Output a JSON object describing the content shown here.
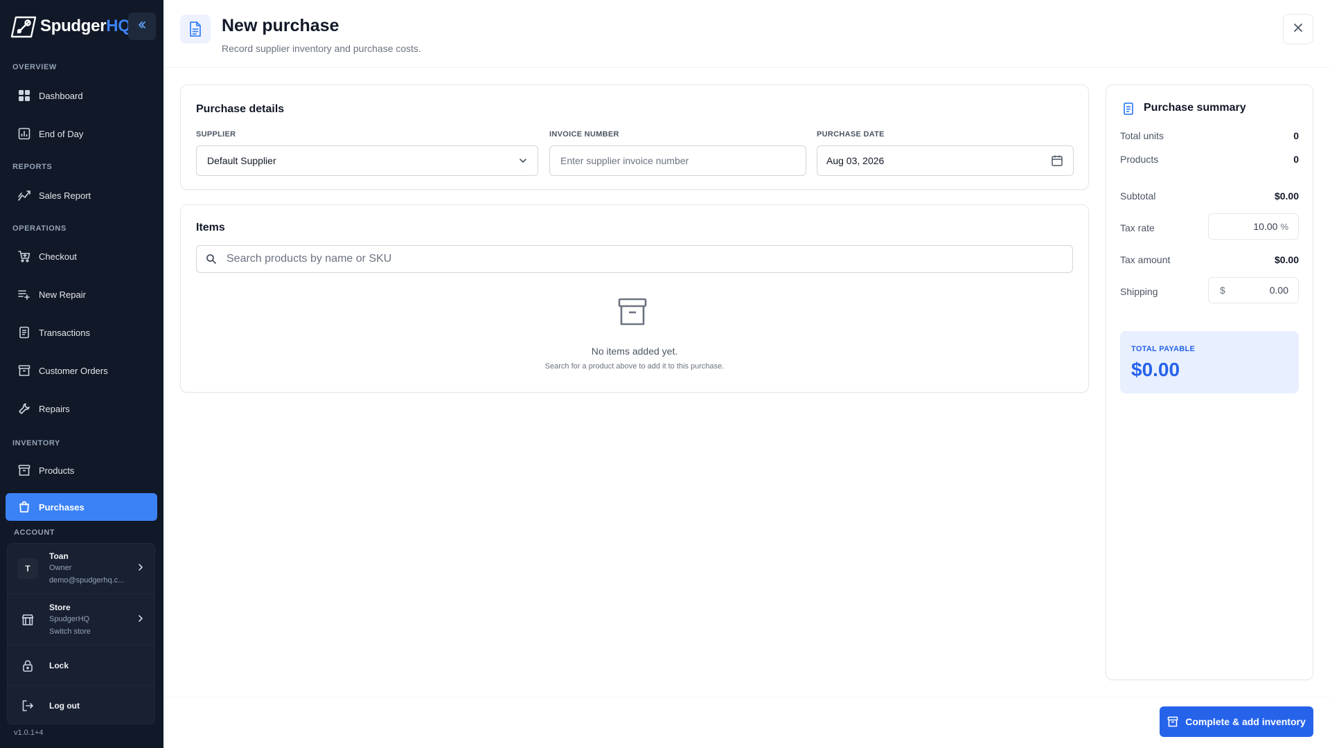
{
  "brand": {
    "name_main": "Spudger",
    "name_accent": "HQ"
  },
  "sidebar": {
    "sections": {
      "overview": "OVERVIEW",
      "reports": "REPORTS",
      "operations": "OPERATIONS",
      "inventory": "INVENTORY",
      "account": "ACCOUNT"
    },
    "items": {
      "dashboard": "Dashboard",
      "end_of_day": "End of Day",
      "sales_report": "Sales Report",
      "checkout": "Checkout",
      "new_repair": "New Repair",
      "transactions": "Transactions",
      "customer_orders": "Customer Orders",
      "repairs": "Repairs",
      "products": "Products",
      "purchases": "Purchases"
    },
    "account": {
      "user_initial": "T",
      "user_name": "Toan",
      "user_role": "Owner",
      "user_email": "demo@spudgerhq.c...",
      "store_title": "Store",
      "store_name": "SpudgerHQ",
      "store_action": "Switch store",
      "lock": "Lock",
      "logout": "Log out"
    },
    "version": "v1.0.1+4"
  },
  "header": {
    "title": "New purchase",
    "subtitle": "Record supplier inventory and purchase costs."
  },
  "purchase_details": {
    "title": "Purchase details",
    "supplier_label": "SUPPLIER",
    "supplier_value": "Default Supplier",
    "invoice_label": "INVOICE NUMBER",
    "invoice_placeholder": "Enter supplier invoice number",
    "date_label": "PURCHASE DATE",
    "date_value": "Aug 03, 2026"
  },
  "items": {
    "title": "Items",
    "search_placeholder": "Search products by name or SKU",
    "empty_title": "No items added yet.",
    "empty_sub": "Search for a product above to add it to this purchase."
  },
  "summary": {
    "title": "Purchase summary",
    "total_units_label": "Total units",
    "total_units": "0",
    "products_label": "Products",
    "products": "0",
    "subtotal_label": "Subtotal",
    "subtotal": "$0.00",
    "tax_rate_label": "Tax rate",
    "tax_rate": "10.00",
    "tax_rate_suffix": "%",
    "tax_amount_label": "Tax amount",
    "tax_amount": "$0.00",
    "shipping_label": "Shipping",
    "shipping_prefix": "$",
    "shipping": "0.00",
    "total_label": "TOTAL PAYABLE",
    "total": "$0.00"
  },
  "footer": {
    "primary_button": "Complete & add inventory"
  },
  "colors": {
    "sidebar_bg": "#111827",
    "accent": "#3b82f6",
    "primary": "#2563eb"
  }
}
